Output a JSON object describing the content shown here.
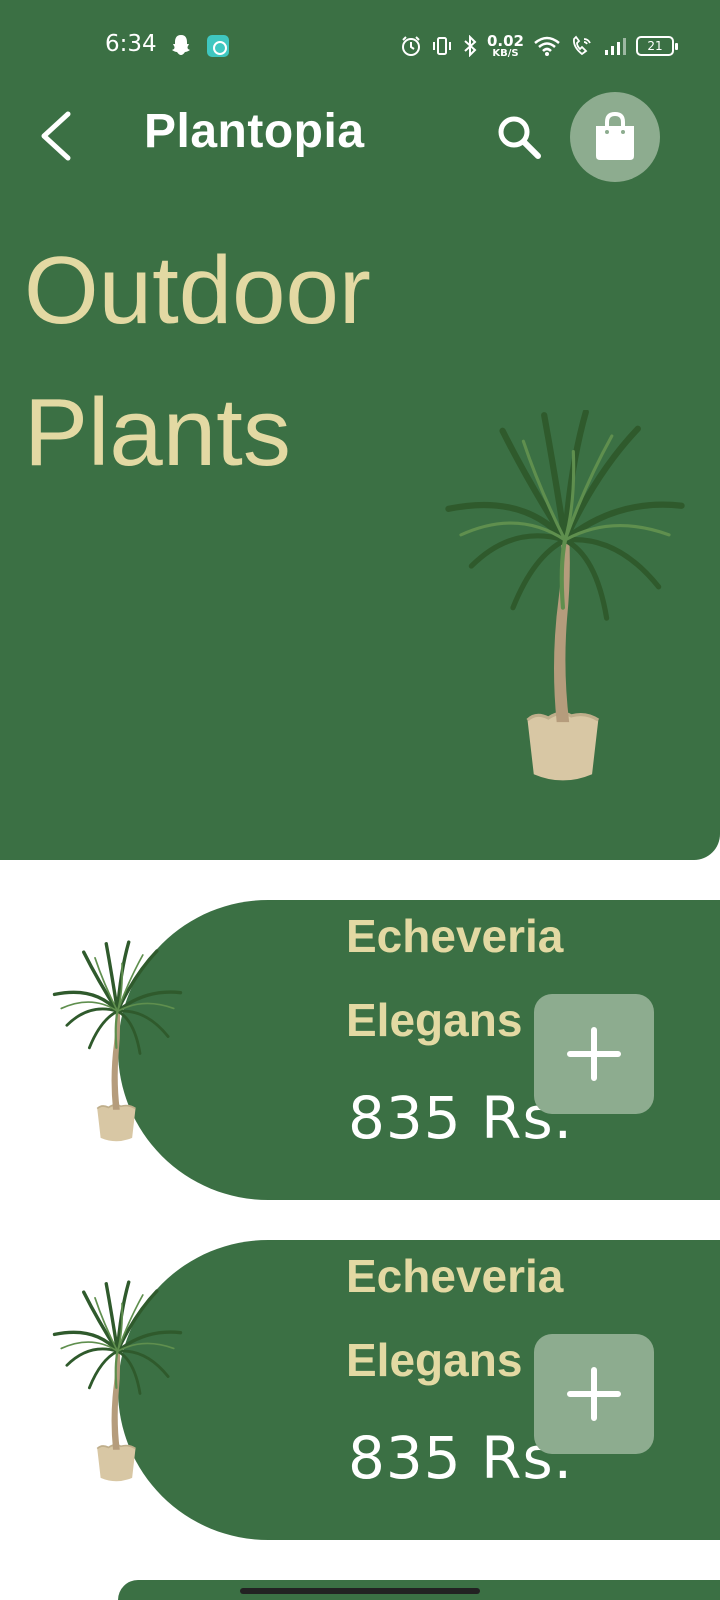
{
  "status_bar": {
    "time": "6:34",
    "net_speed_value": "0.02",
    "net_speed_unit": "KB/S",
    "battery": "21",
    "icons": [
      "snapchat-ghost-icon",
      "app-notification-icon",
      "alarm-icon",
      "vibrate-icon",
      "bluetooth-icon",
      "wifi-icon",
      "wifi-calling-icon",
      "signal-icon",
      "battery-icon"
    ]
  },
  "app_bar": {
    "title": "Plantopia",
    "back_icon": "chevron-left-icon",
    "search_icon": "search-icon",
    "cart_icon": "shopping-bag-icon"
  },
  "hero": {
    "title_line1": "Outdoor",
    "title_line2": "Plants"
  },
  "products": [
    {
      "name_line1": "Echeveria",
      "name_line2": "Elegans",
      "price": "835 Rs.",
      "add_label": "+"
    },
    {
      "name_line1": "Echeveria",
      "name_line2": "Elegans",
      "price": "835 Rs.",
      "add_label": "+"
    }
  ],
  "colors": {
    "primary_green": "#3b7044",
    "accent_cream": "#e3d9a3",
    "button_sage": "#8dac8f",
    "background": "#ffffff"
  }
}
